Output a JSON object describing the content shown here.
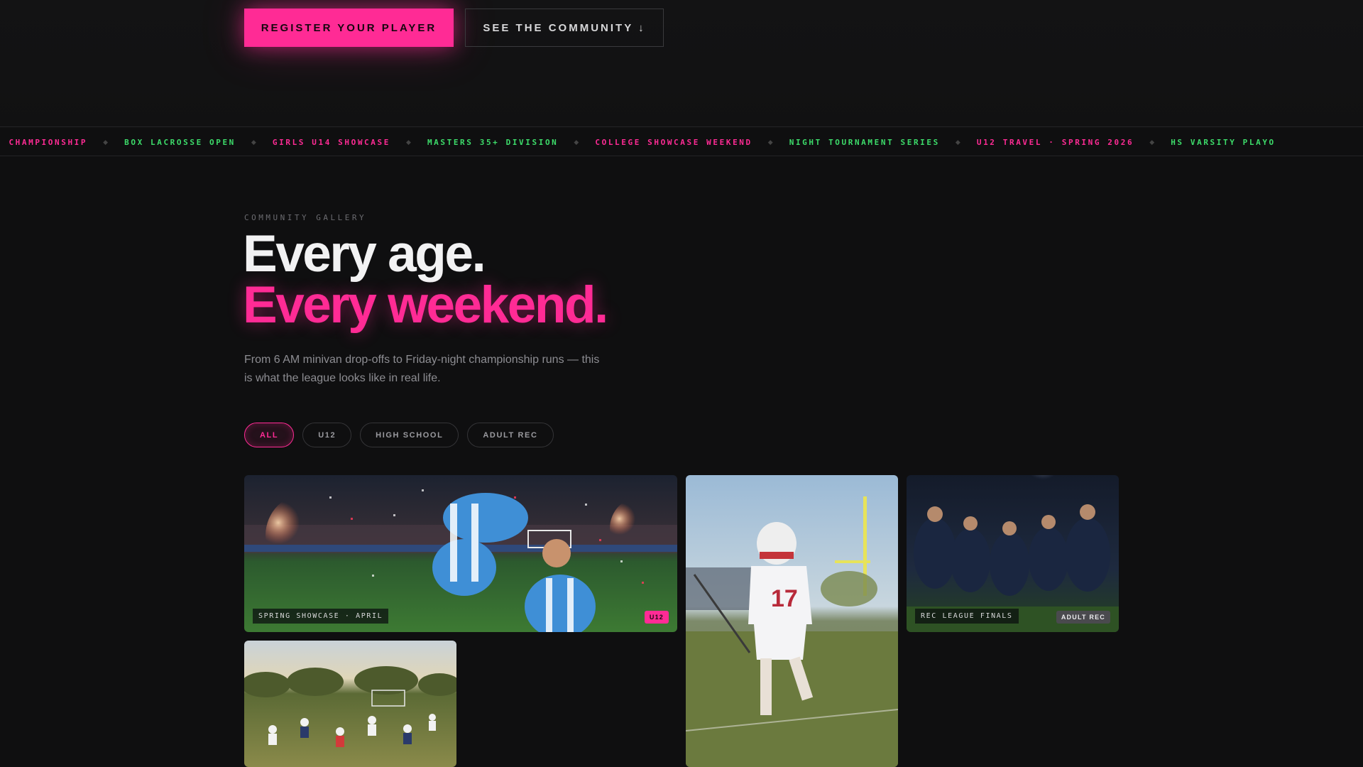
{
  "hero": {
    "primary_cta": "REGISTER YOUR PLAYER",
    "secondary_cta": "SEE THE COMMUNITY ↓"
  },
  "ticker": {
    "separator": "◆",
    "items": [
      {
        "label": "C CHAMPIONSHIP",
        "color": "#ff2b95"
      },
      {
        "label": "BOX LACROSSE OPEN",
        "color": "#3ddc6a"
      },
      {
        "label": "GIRLS U14 SHOWCASE",
        "color": "#ff2b95"
      },
      {
        "label": "MASTERS 35+ DIVISION",
        "color": "#3ddc6a"
      },
      {
        "label": "COLLEGE SHOWCASE WEEKEND",
        "color": "#ff2b95"
      },
      {
        "label": "NIGHT TOURNAMENT SERIES",
        "color": "#3ddc6a"
      },
      {
        "label": "U12 TRAVEL · SPRING 2026",
        "color": "#ff2b95"
      },
      {
        "label": "HS VARSITY PLAYO",
        "color": "#3ddc6a"
      }
    ]
  },
  "gallery": {
    "eyebrow": "COMMUNITY GALLERY",
    "headline_line1": "Every age.",
    "headline_line2": "Every weekend.",
    "lede": "From 6 AM minivan drop-offs to Friday-night championship runs — this is what the league looks like in real life.",
    "filters": [
      {
        "label": "ALL",
        "active": true
      },
      {
        "label": "U12",
        "active": false
      },
      {
        "label": "HIGH SCHOOL",
        "active": false
      },
      {
        "label": "ADULT REC",
        "active": false
      }
    ],
    "cards": [
      {
        "caption": "SPRING SHOWCASE · APRIL",
        "tag": "U12"
      },
      {
        "caption": "",
        "tag": ""
      },
      {
        "caption": "REC LEAGUE FINALS",
        "tag": "ADULT REC"
      },
      {
        "caption": "",
        "tag": ""
      }
    ]
  },
  "colors": {
    "accent": "#ff2b95",
    "ticker_green": "#3ddc6a",
    "background": "#0f0f10"
  }
}
